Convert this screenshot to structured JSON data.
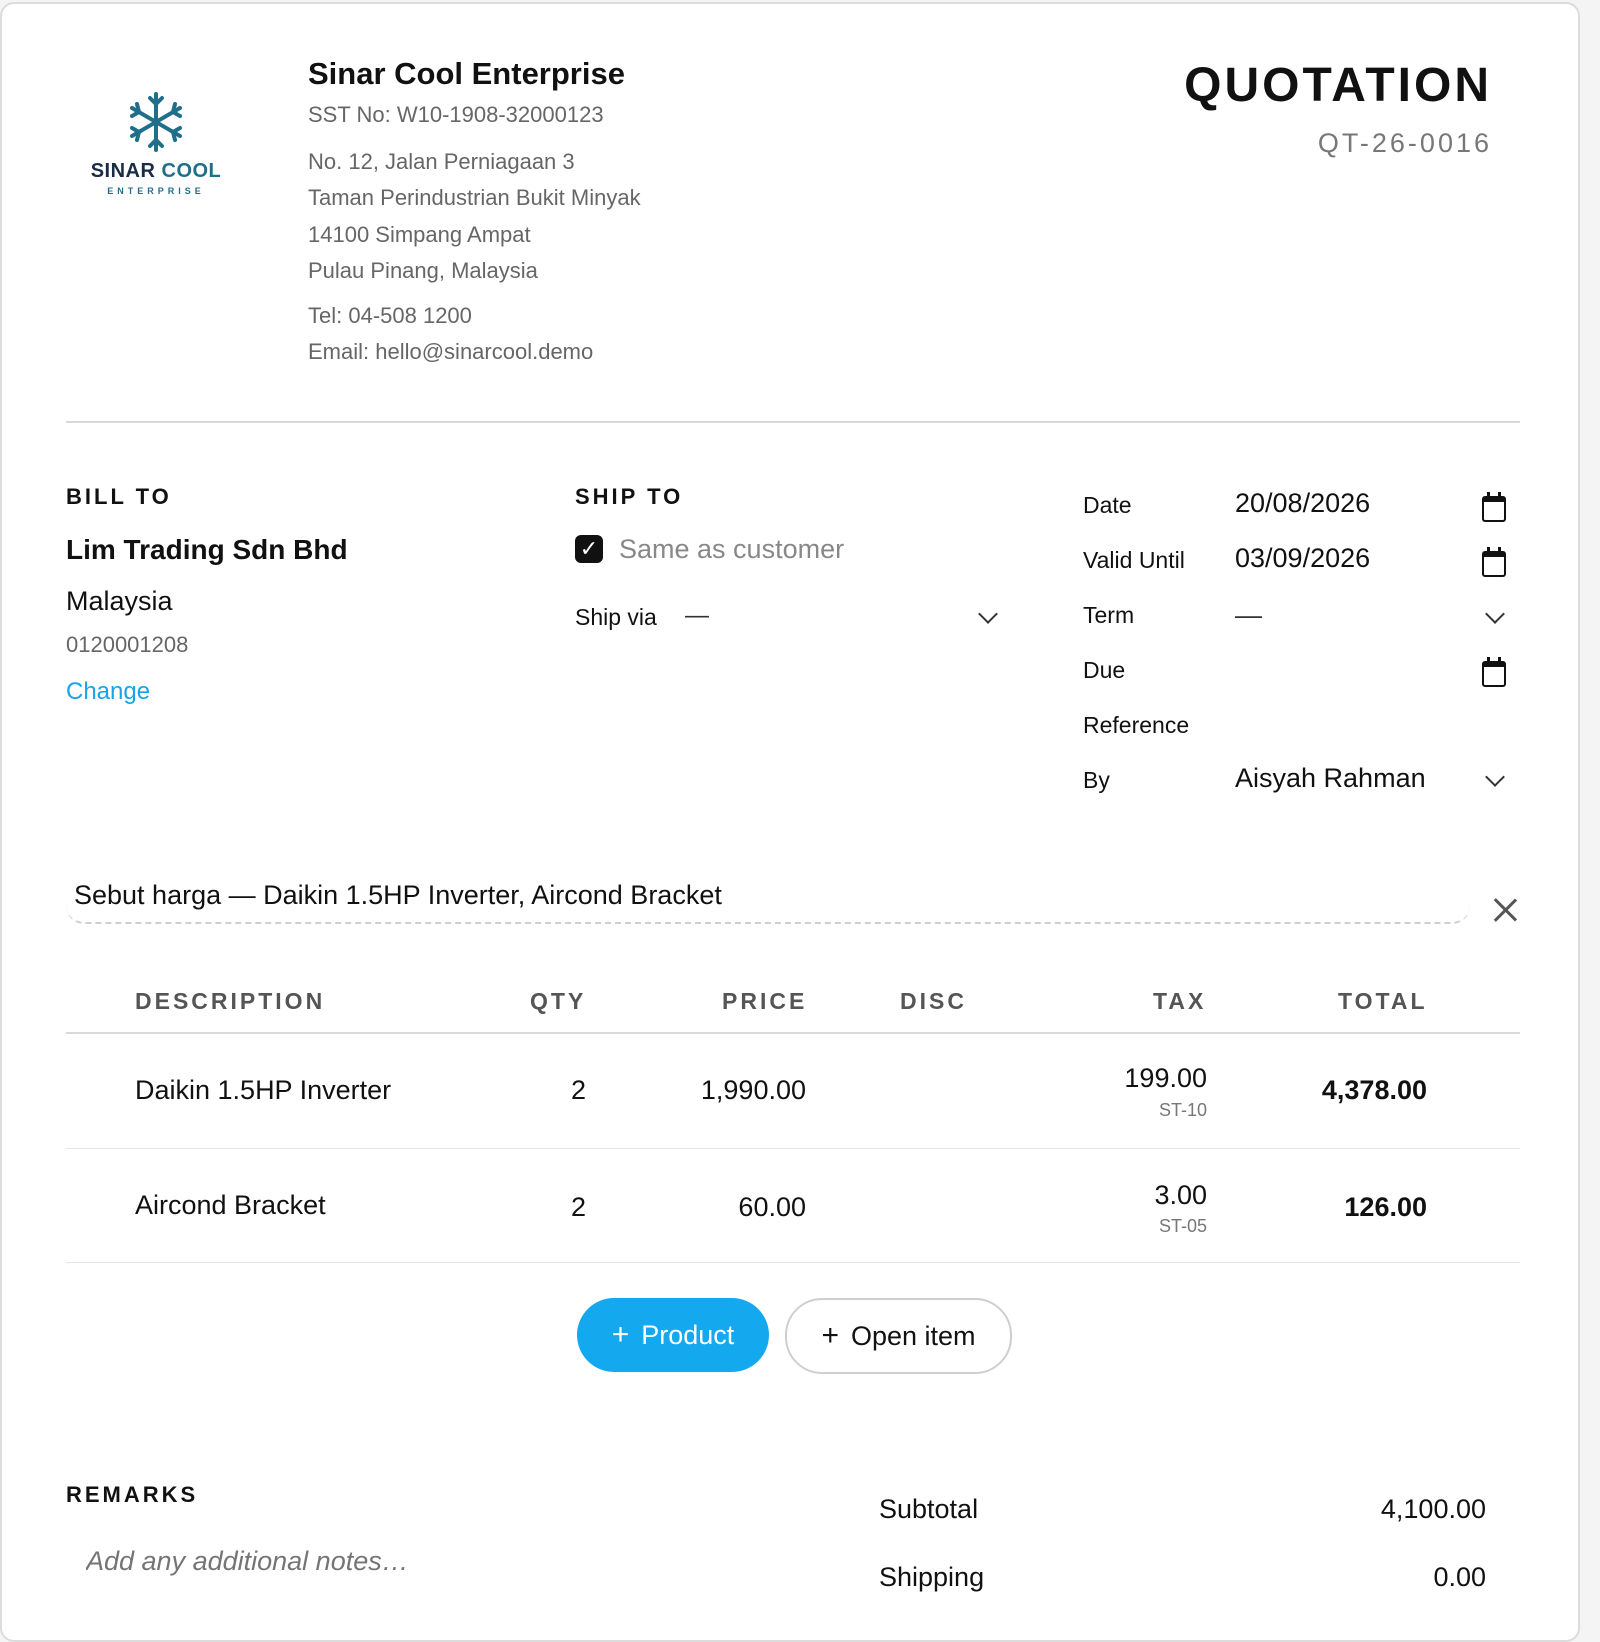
{
  "company": {
    "logo_word_1": "SINAR",
    "logo_word_2": "COOL",
    "logo_sub": "ENTERPRISE",
    "name": "Sinar Cool Enterprise",
    "sst": "SST No: W10-1908-32000123",
    "address": [
      "No. 12, Jalan Perniagaan 3",
      "Taman Perindustrian Bukit Minyak",
      "14100 Simpang Ampat",
      "Pulau Pinang, Malaysia"
    ],
    "tel": "Tel: 04-508 1200",
    "email": "Email: hello@sinarcool.demo"
  },
  "document": {
    "title": "QUOTATION",
    "number": "QT-26-0016"
  },
  "bill_to": {
    "label": "BILL TO",
    "name": "Lim Trading Sdn Bhd",
    "country": "Malaysia",
    "phone": "0120001208",
    "change_label": "Change"
  },
  "ship_to": {
    "label": "SHIP TO",
    "same_as_customer": true,
    "same_label": "Same as customer",
    "ship_via_label": "Ship via",
    "ship_via_value": "—"
  },
  "meta": {
    "date_label": "Date",
    "date_value": "20/08/2026",
    "valid_label": "Valid Until",
    "valid_value": "03/09/2026",
    "term_label": "Term",
    "term_value": "—",
    "due_label": "Due",
    "due_value": "",
    "reference_label": "Reference",
    "reference_value": "",
    "by_label": "By",
    "by_value": "Aisyah Rahman"
  },
  "subject": "Sebut harga — Daikin 1.5HP Inverter, Aircond Bracket",
  "table": {
    "headers": {
      "description": "DESCRIPTION",
      "qty": "QTY",
      "price": "PRICE",
      "disc": "DISC",
      "tax": "TAX",
      "total": "TOTAL"
    },
    "rows": [
      {
        "description": "Daikin 1.5HP Inverter",
        "qty": "2",
        "price": "1,990.00",
        "disc": "",
        "tax": "199.00",
        "tax_code": "ST-10",
        "total": "4,378.00"
      },
      {
        "description": "Aircond Bracket",
        "qty": "2",
        "price": "60.00",
        "disc": "",
        "tax": "3.00",
        "tax_code": "ST-05",
        "total": "126.00"
      }
    ]
  },
  "actions": {
    "add_product": "Product",
    "add_open_item": "Open item",
    "plus_glyph": "+"
  },
  "remarks": {
    "label": "REMARKS",
    "placeholder": "Add any additional notes…"
  },
  "summary": {
    "subtotal_label": "Subtotal",
    "subtotal_value": "4,100.00",
    "shipping_label": "Shipping",
    "shipping_value": "0.00"
  },
  "colors": {
    "accent": "#14a8ef",
    "link": "#1aa3e8",
    "logo": "#1f6f8b"
  }
}
